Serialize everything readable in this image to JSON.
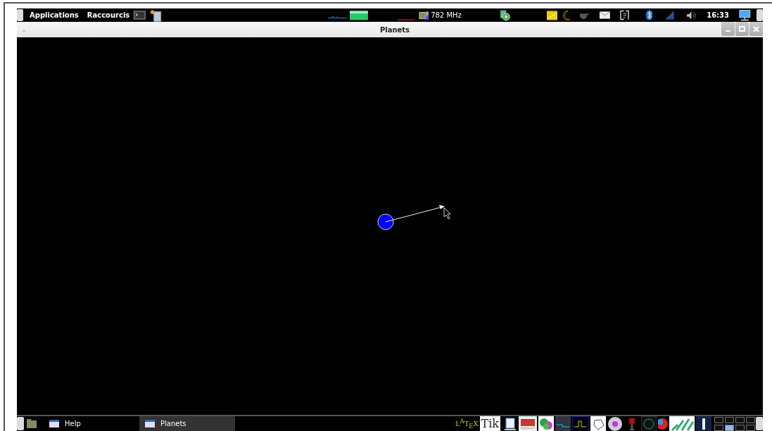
{
  "top_panel": {
    "menus": [
      {
        "label": "Applications"
      },
      {
        "label": "Raccourcis"
      }
    ],
    "cpu_frequency": "782 MHz",
    "clock": "16:33"
  },
  "window": {
    "title": "Planets"
  },
  "taskbar": {
    "tasks": [
      {
        "label": "Help",
        "selected": false
      },
      {
        "label": "Planets",
        "selected": true
      }
    ],
    "launchers": [
      {
        "kind": "latex",
        "label": "L$^{A}$T$_{E}$X"
      },
      {
        "kind": "tikz",
        "label": "Tik"
      },
      {
        "kind": "editor"
      },
      {
        "kind": "si"
      },
      {
        "kind": "molecule"
      },
      {
        "kind": "scope"
      },
      {
        "kind": "plot"
      },
      {
        "kind": "geometry"
      },
      {
        "kind": "sphere"
      },
      {
        "kind": "wine"
      },
      {
        "kind": "dark"
      },
      {
        "kind": "blob"
      },
      {
        "kind": "bars"
      },
      {
        "kind": "bottle"
      }
    ]
  }
}
